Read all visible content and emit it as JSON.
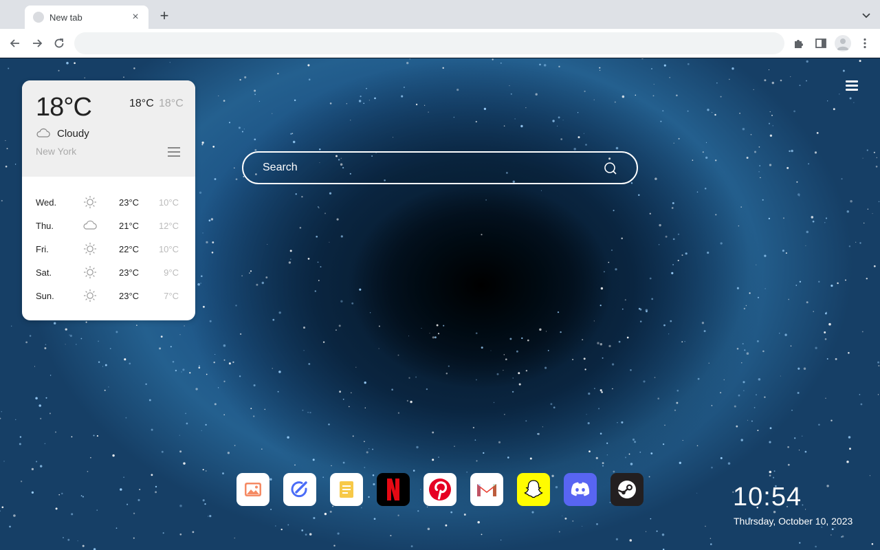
{
  "browser": {
    "tab_title": "New tab",
    "tab_close": "×",
    "new_tab": "+",
    "address_value": ""
  },
  "weather": {
    "current_temp": "18°C",
    "high": "18°C",
    "low": "18°C",
    "condition": "Cloudy",
    "condition_icon": "cloud-icon",
    "city": "New York",
    "forecast": [
      {
        "day": "Wed.",
        "icon": "sun-icon",
        "high": "23°C",
        "low": "10°C"
      },
      {
        "day": "Thu.",
        "icon": "cloud-icon",
        "high": "21°C",
        "low": "12°C"
      },
      {
        "day": "Fri.",
        "icon": "sun-icon",
        "high": "22°C",
        "low": "10°C"
      },
      {
        "day": "Sat.",
        "icon": "sun-icon",
        "high": "23°C",
        "low": "9°C"
      },
      {
        "day": "Sun.",
        "icon": "sun-icon",
        "high": "23°C",
        "low": "7°C"
      }
    ]
  },
  "search": {
    "placeholder": "Search"
  },
  "dock": [
    {
      "name": "photos",
      "icon": "photos-icon",
      "color": "#ffffff"
    },
    {
      "name": "tasks",
      "icon": "tasks-icon",
      "color": "#ffffff"
    },
    {
      "name": "notes",
      "icon": "notes-icon",
      "color": "#ffffff"
    },
    {
      "name": "netflix",
      "icon": "netflix-icon",
      "color": "#000000"
    },
    {
      "name": "pinterest",
      "icon": "pinterest-icon",
      "color": "#ffffff"
    },
    {
      "name": "gmail",
      "icon": "gmail-icon",
      "color": "#ffffff"
    },
    {
      "name": "snapchat",
      "icon": "snapchat-icon",
      "color": "#fffc00"
    },
    {
      "name": "discord",
      "icon": "discord-icon",
      "color": "#5865f2"
    },
    {
      "name": "steam",
      "icon": "steam-icon",
      "color": "#231f20"
    }
  ],
  "clock": {
    "time": "10:54",
    "date": "Thursday, October 10, 2023"
  }
}
